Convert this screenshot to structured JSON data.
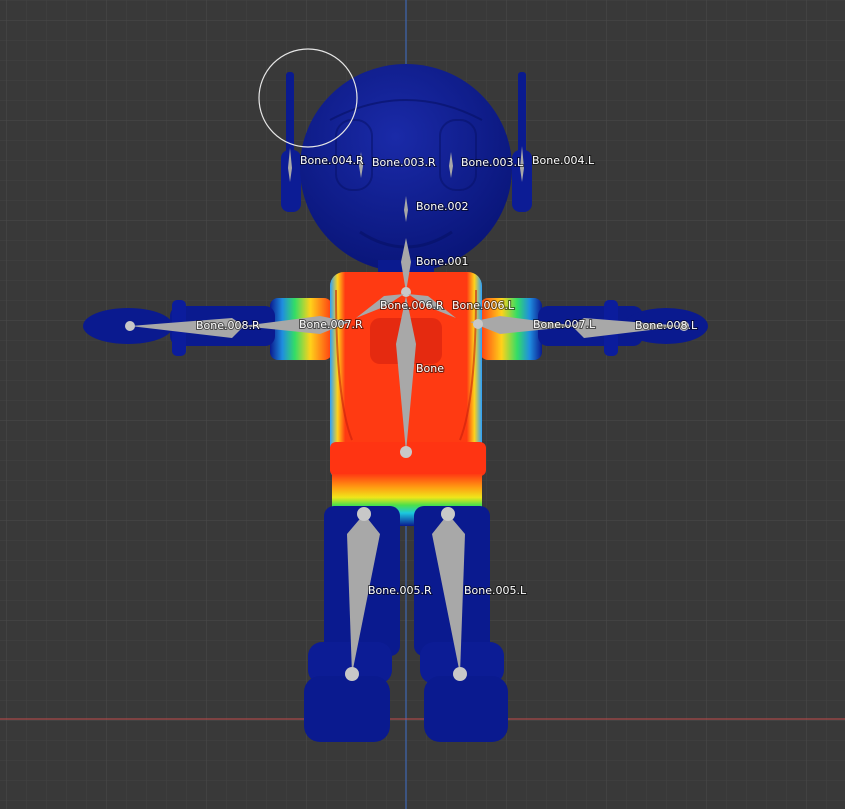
{
  "viewport": {
    "name": "3D viewport - weight paint mode",
    "background": "#393939",
    "grid_color": "#444444",
    "axis_x_color": "#c44a4a",
    "axis_y_color": "#3f6fc9",
    "brush_cursor_color": "#e6e6e6"
  },
  "character": {
    "mesh_zero_weight_color": "#0a1a8f",
    "mesh_full_weight_color": "#ff2a1a",
    "bone_color": "#a8a8a8"
  },
  "bones": {
    "bone": "Bone",
    "bone_001": "Bone.001",
    "bone_002": "Bone.002",
    "bone_003_r": "Bone.003.R",
    "bone_003_l": "Bone.003.L",
    "bone_004_r": "Bone.004.R",
    "bone_004_l": "Bone.004.L",
    "bone_005_r": "Bone.005.R",
    "bone_005_l": "Bone.005.L",
    "bone_006_r": "Bone.006.R",
    "bone_006_l": "Bone.006.L",
    "bone_007_r": "Bone.007.R",
    "bone_007_l": "Bone.007.L",
    "bone_008_r": "Bone.008.R",
    "bone_008_l": "Bone.008.L"
  }
}
